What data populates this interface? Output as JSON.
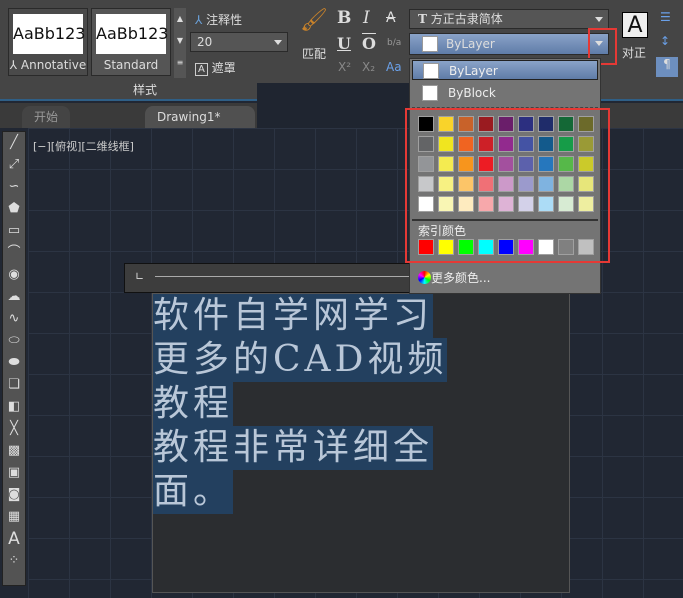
{
  "ribbon": {
    "styles": [
      {
        "preview": "AaBb123",
        "label": "Annotative"
      },
      {
        "preview": "AaBb123",
        "label": "Standard"
      }
    ],
    "panel_label": "样式",
    "annotative_label": "注释性",
    "height_value": "20",
    "mask_label": "遮罩",
    "match_label": "匹配",
    "bold": "B",
    "italic": "I",
    "strike": "A",
    "underline": "U",
    "overline": "O",
    "stack": "b/a",
    "superscript": "X²",
    "subscript": "X₂",
    "case": "Aa",
    "font_value": "方正古隶简体",
    "color_value": "ByLayer",
    "justify_label": "对正"
  },
  "tabs": [
    {
      "label": "开始"
    },
    {
      "label": "Drawing1*"
    }
  ],
  "viewport_label": "[−][俯视][二维线框]",
  "text_lines": [
    "软件自学网学习",
    "更多的CAD视频",
    "教程",
    "教程非常详细全",
    "面。"
  ],
  "dropdown": {
    "options": [
      "ByLayer",
      "ByBlock"
    ],
    "palette": [
      [
        "#000000",
        "#f9d32a",
        "#c8622a",
        "#9a1b20",
        "#6a1e6a",
        "#2c2f80",
        "#1f2c6a",
        "#146836",
        "#6c6a2a"
      ],
      [
        "#636466",
        "#f0e51f",
        "#f06421",
        "#cd2027",
        "#922a8e",
        "#4453a4",
        "#135a8c",
        "#169c48",
        "#9a9a36"
      ],
      [
        "#939598",
        "#f4eb50",
        "#f7951d",
        "#ed1c24",
        "#a3509e",
        "#5c61ac",
        "#2677bd",
        "#56b849",
        "#cbca2a"
      ],
      [
        "#c7c8ca",
        "#f7f182",
        "#fcc568",
        "#f07076",
        "#cc99c9",
        "#9b9acc",
        "#7fb3e0",
        "#acd7a5",
        "#e7e67a"
      ],
      [
        "#ffffff",
        "#f9f6b4",
        "#feebbf",
        "#f7a8ab",
        "#deb3d6",
        "#d3d1e9",
        "#acdcf6",
        "#d7ebd3",
        "#eeeea0"
      ]
    ],
    "index_label": "索引颜色",
    "index_colors": [
      "#ff0000",
      "#ffff00",
      "#00ff00",
      "#00ffff",
      "#0000ff",
      "#ff00ff",
      "#ffffff",
      "#808080",
      "#c0c0c0"
    ],
    "more_label": "更多颜色..."
  }
}
